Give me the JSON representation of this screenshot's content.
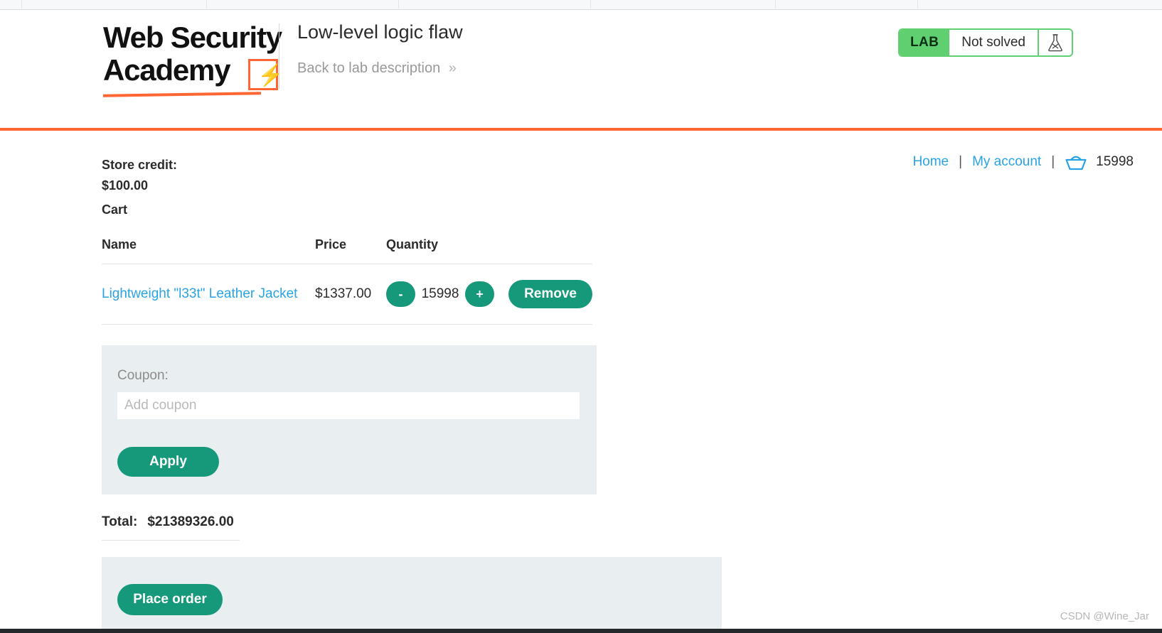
{
  "browser": {
    "tab_strip_visible": true
  },
  "academy_header": {
    "logo": {
      "line1": "Web Security",
      "line2": "Academy",
      "bolt_glyph": "⚡",
      "accent_color": "#ff6633"
    },
    "lab_title": "Low-level logic flaw",
    "back_link": {
      "label": "Back to lab description",
      "chevrons": "»"
    },
    "lab_status": {
      "tag": "LAB",
      "state": "Not solved",
      "flask_icon": "flask-icon",
      "accent_color": "#5fcf70"
    },
    "rule_color": "#ff6633"
  },
  "shop": {
    "store_credit": {
      "label": "Store credit:",
      "amount": "$100.00"
    },
    "topnav": {
      "home": "Home",
      "my_account": "My account",
      "separator": "|",
      "basket_icon": "shopping-basket-icon",
      "cart_count": "15998",
      "link_color": "#29a3e3"
    },
    "cart_heading": "Cart",
    "table": {
      "columns": [
        "Name",
        "Price",
        "Quantity"
      ],
      "rows": [
        {
          "name": "Lightweight \"l33t\" Leather Jacket",
          "price": "$1337.00",
          "quantity": "15998",
          "decrement_label": "-",
          "increment_label": "+",
          "remove_label": "Remove"
        }
      ]
    },
    "coupon": {
      "label": "Coupon:",
      "value": "",
      "placeholder": "Add coupon",
      "apply_label": "Apply",
      "panel_color": "#e9eef0"
    },
    "total": {
      "label": "Total:",
      "amount": "$21389326.00"
    },
    "order": {
      "place_order_label": "Place order"
    },
    "button_color": "#16997b"
  },
  "watermark": "CSDN @Wine_Jar"
}
